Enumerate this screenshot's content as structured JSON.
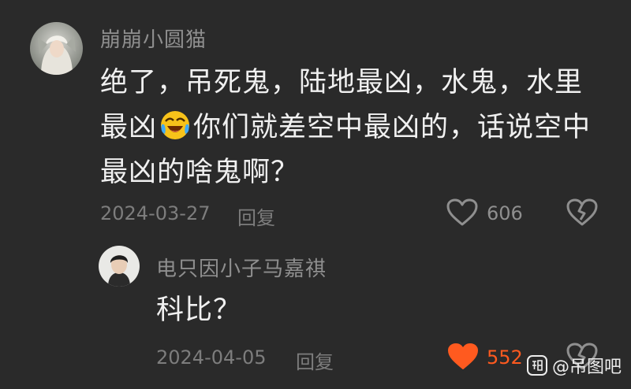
{
  "comments": [
    {
      "username": "崩崩小圆猫",
      "text_parts": [
        "绝了，吊死鬼，陆地最凶，水鬼，水里最凶",
        "你们就差空中最凶的，话说空中最凶的啥鬼啊？"
      ],
      "emoji": "crying-laughing-emoji",
      "date": "2024-03-27",
      "reply_label": "回复",
      "like_count": "606",
      "liked": false
    },
    {
      "username": "电只因小子马嘉祺",
      "text": "科比？",
      "date": "2024-04-05",
      "reply_label": "回复",
      "like_count": "552",
      "liked": true
    }
  ],
  "watermark": {
    "text": "@吊图吧",
    "icon": "tieba-logo-icon"
  },
  "colors": {
    "background": "#2a2a2a",
    "username": "#8f8f8f",
    "body_text": "#f0f0f0",
    "meta_text": "#7d7d7d",
    "like_active": "#ff5a1f"
  }
}
